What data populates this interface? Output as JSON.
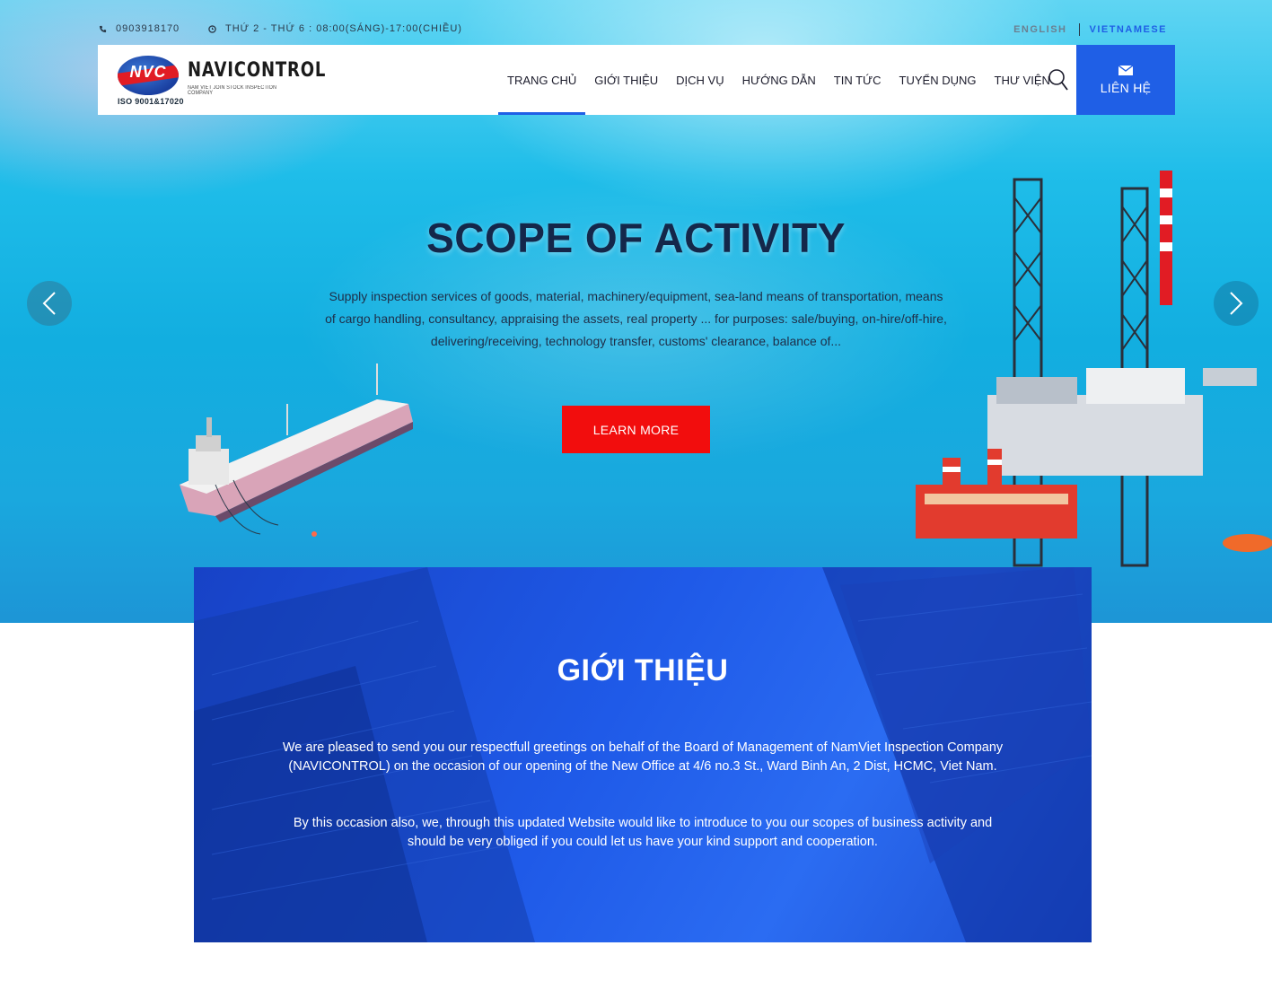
{
  "topbar": {
    "phone": "0903918170",
    "hours": "THỨ 2 - THỨ 6 : 08:00(SÁNG)-17:00(CHIỀU)",
    "lang_en": "ENGLISH",
    "lang_vi": "VIETNAMESE"
  },
  "logo": {
    "mark": "NVC",
    "name": "NAVICONTROL",
    "subtitle": "NAM VIET JOIN STOCK INSPECTION COMPANY",
    "iso": "ISO 9001&17020"
  },
  "nav": {
    "items": [
      {
        "label": "TRANG CHỦ",
        "active": true
      },
      {
        "label": "GIỚI THIỆU"
      },
      {
        "label": "DỊCH VỤ"
      },
      {
        "label": "HƯỚNG DẪN"
      },
      {
        "label": "TIN TỨC"
      },
      {
        "label": "TUYỂN DỤNG"
      },
      {
        "label": "THƯ VIỆN"
      }
    ],
    "search_icon": "search-icon",
    "contact_label": "LIÊN HỆ",
    "contact_icon": "mail-icon"
  },
  "slide": {
    "title": "SCOPE OF ACTIVITY",
    "description": "Supply inspection services of goods, material, machinery/equipment, sea-land means of transportation, means of cargo handling, consultancy, appraising the assets, real property ... for purposes: sale/buying, on-hire/off-hire, delivering/receiving, technology transfer, customs' clearance, balance of...",
    "button": "LEARN MORE"
  },
  "intro": {
    "title": "GIỚI THIỆU",
    "paragraph1": "We are pleased to send you our respectfull greetings on behalf of the Board of Management of NamViet Inspection Company (NAVICONTROL) on the occasion of our opening of the New Office at 4/6 no.3 St., Ward Binh An, 2 Dist, HCMC, Viet Nam.",
    "paragraph2": "By this occasion also, we, through this updated Website would like to introduce to you our scopes of business activity and should be very obliged if you could let us have your kind support and cooperation."
  },
  "colors": {
    "accent": "#1f5fe6",
    "cta": "#f20d0d",
    "title": "#14274a"
  }
}
